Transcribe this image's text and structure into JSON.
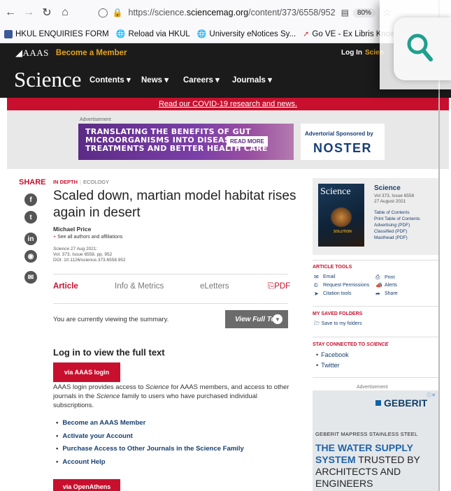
{
  "browser": {
    "url_prefix": "https://science.",
    "url_domain": "sciencemag.org",
    "url_path": "/content/373/6558/952",
    "zoom": "80%",
    "bookmarks": [
      "HKUL ENQUIRIES FORM",
      "Reload via HKUL",
      "University eNotices Sy...",
      "Go VE - Ex Libris Know..."
    ]
  },
  "header": {
    "aaas_logo": "AAAS",
    "become_member": "Become a Member",
    "log_in": "Log In",
    "science_link": "Scien",
    "science_logo": "Science",
    "menu": [
      "Contents ▾",
      "News ▾",
      "Careers ▾",
      "Journals ▾"
    ]
  },
  "covid_banner": "Read our COVID-19 research and news.",
  "ad_top": {
    "label": "Advertisement",
    "headline": [
      "TRANSLATING THE BENEFITS OF GUT",
      "MICROORGANISMS INTO DISEASE",
      "TREATMENTS AND BETTER HEALTH CARE"
    ],
    "read_more": "READ MORE",
    "sponsor_label": "Advertorial Sponsored by",
    "sponsor": "NOSTER"
  },
  "share_label": "SHARE",
  "article": {
    "section": "IN DEPTH",
    "subsection": "ECOLOGY",
    "title": "Scaled down, martian model habitat rises again in desert",
    "author": "Michael Price",
    "affiliations": "See all authors and affiliations",
    "cite_journal": "Science",
    "cite_date": " 27 Aug 2021:",
    "cite_vol": "Vol. 373, Issue 6558, pp. 952",
    "cite_doi": "DOI: 10.1126/science.373.6558.952",
    "tabs": [
      "Article",
      "Info & Metrics",
      "eLetters",
      "PDF"
    ],
    "summary_note": "You are currently viewing the summary.",
    "view_full_text": "View Full Text",
    "login_heading": "Log in to view the full text",
    "via_aaas": "via AAAS login",
    "login_text_1": "AAAS login provides access to ",
    "login_text_science": "Science",
    "login_text_2": " for AAAS members, and access to other journals in the ",
    "login_text_3": " family to users who have purchased individual subscriptions.",
    "links": [
      "Become an AAAS Member",
      "Activate your Account",
      "Purchase Access to Other Journals in the Science Family",
      "Account Help"
    ],
    "via_openathens": "via OpenAthens"
  },
  "sidebar": {
    "cover_title": "Science",
    "cover_tag": "SOLUTION",
    "issue_title": "Science",
    "issue_vol": "Vol 373, Issue 6558",
    "issue_date": "27 August 2021",
    "issue_links": [
      "Table of Contents",
      "Print Table of Contents",
      "Advertising (PDF)",
      "Classified (PDF)",
      "Masthead (PDF)"
    ],
    "article_tools_heading": "ARTICLE TOOLS",
    "tools": [
      "Email",
      "Print",
      "Request Permissions",
      "Alerts",
      "Citation tools",
      "Share"
    ],
    "saved_heading": "MY SAVED FOLDERS",
    "saved_link": "Save to my folders",
    "stay_heading": "STAY CONNECTED TO ",
    "stay_heading_em": "SCIENCE",
    "social": [
      "Facebook",
      "Twitter"
    ],
    "ad_label": "Advertisement",
    "ad_brand": "GEBERIT",
    "ad_line1": "GEBERIT MAPRESS STAINLESS STEEL",
    "ad_big_1": "THE WATER SUPPLY",
    "ad_big_2": "SYSTEM",
    "ad_big_3": " TRUSTED BY ARCHITECTS AND ENGINEERS"
  }
}
